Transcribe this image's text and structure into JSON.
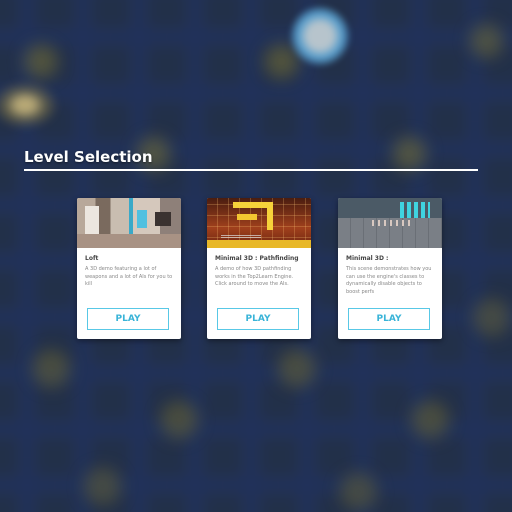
{
  "header": {
    "title": "Level Selection"
  },
  "levels": [
    {
      "title": "Loft",
      "description": "A 3D demo featuring a lot of weapons and a lot of AIs for you to kill",
      "play_label": "PLAY"
    },
    {
      "title": "Minimal 3D : Pathfinding",
      "description": "A demo of how 3D pathfinding works in the Top2Learn Engine. Click around to move the AIs.",
      "play_label": "PLAY"
    },
    {
      "title": "Minimal 3D :",
      "description": "This scene demonstrates how you can use the engine's classes to dynamically disable objects to boost perfs",
      "play_label": "PLAY"
    }
  ],
  "colors": {
    "accent": "#3ab4d8",
    "card_bg": "#ffffff",
    "title_text": "#ffffff"
  }
}
